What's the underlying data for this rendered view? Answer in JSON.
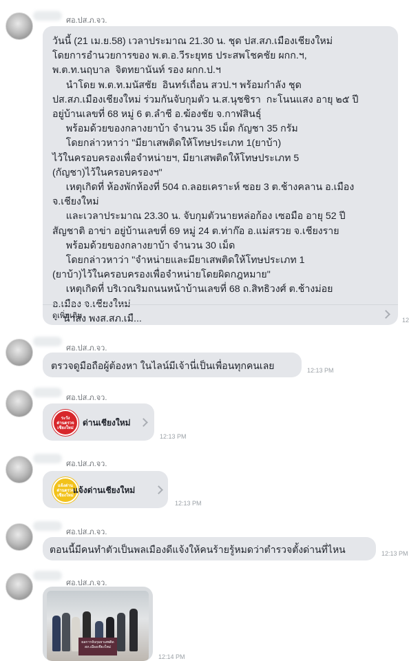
{
  "messages": [
    {
      "sender": "ศอ.ปส.ภ.จว.",
      "type": "text",
      "lines": [
        "วันนี้ (21 เม.ย.58) เวลาประมาณ 21.30 น. ชุด ปส.สภ.เมืองเชียงใหม่",
        "โดยการอำนวยการของ พ.ต.อ.วีระยุทธ ประสพโชคชัย ผกก.ฯ,",
        "พ.ต.ท.นฤบาล  จิตทยานันท์ รอง ผกก.ป.ฯ",
        "     นำโดย พ.ต.ท.มนัสชัย  อินทร์เถื่อน สวป.ฯ พร้อมกำลัง ชุด",
        "ปส.สภ.เมืองเชียงใหม่ ร่วมกันจับกุมตัว น.ส.นุชชิรา  กะโนนแสง อายุ ๒๕ ปี",
        "อยู่บ้านเลขที่ 68 หมู่ 6 ต.ลำชี อ.ฆ้องชัย จ.กาฬสินธุ์",
        "     พร้อมด้วยของกลางยาบ้า จำนวน 35 เม็ด กัญชา 35 กรัม",
        "     โดยกล่าวหาว่า \"มียาเสพติดให้โทษประเภท 1(ยาบ้า)",
        "ไว้ในครอบครองเพื่อจำหน่ายฯ, มียาเสพติดให้โทษประเภท 5",
        "(กัญชา)ไว้ในครอบครองฯ\"",
        "     เหตุเกิดที่ ห้องพักห้องที่ 504 ถ.ลอยเคราะห์ ซอย 3 ต.ช้างคลาน อ.เมือง",
        "จ.เชียงใหม่",
        "     และเวลาประมาณ 23.30 น. จับกุมตัวนายหล่อก้อง เซอมือ อายุ 52 ปี",
        "สัญชาติ อาข่า อยู่บ้านเลขที่ 69 หมู่ 24 ต.ท่าก๊อ อ.แม่สรวย จ.เชียงราย",
        "     พร้อมด้วยของกลางยาบ้า จำนวน 30 เม็ด",
        "     โดยกล่าวหาว่า \"จำหน่ายและมียาเสพติดให้โทษประเภท 1",
        "(ยาบ้า)ไว้ในครอบครองเพื่อจำหน่ายโดยผิดกฎหมาย\"",
        "     เหตุเกิดที่ บริเวณริมถนนหน้าบ้านเลขที่ 68 ถ.สิทธิวงศ์ ต.ช้างม่อย",
        "อ.เมือง จ.เชียงใหม่",
        "    นำส่ง พงส.สภ.เมื..."
      ],
      "see_more": "ดูเพิ่มเติม",
      "time": "12:"
    },
    {
      "sender": "ศอ.ปส.ภ.จว.",
      "type": "text",
      "text": "ตรวจดูมือถือผู้ต้องหา ในไลน์มีเจ้านี่เป็นเพื่อนทุกคนเลย",
      "time": "12:13 PM"
    },
    {
      "sender": "ศอ.ปส.ภ.จว.",
      "type": "link",
      "label": "ด่านเชียงใหม่",
      "logo_text": [
        "ระวัง",
        "ด่านตรวจ",
        "เชียงใหม่"
      ],
      "logo_color": "#d7262b",
      "time": "12:13 PM"
    },
    {
      "sender": "ศอ.ปส.ภ.จว.",
      "type": "link",
      "label": "แจ้งด่านเชียงใหม่",
      "logo_text": [
        "แจ้งด่าน",
        "ด่านตรวจ",
        "เชียงใหม่"
      ],
      "logo_color": "#f2c21b",
      "time": "12:13 PM"
    },
    {
      "sender": "ศอ.ปส.ภ.จว.",
      "type": "text",
      "text": "ตอนนี้มีคนทำตัวเป็นพลเมืองดีแจ้งให้คนร้ายรู้หมดว่าตำรวจตั้งด่านที่ไหน",
      "time": "12:13 PM"
    },
    {
      "sender": "ศอ.ปส.ภ.จว.",
      "type": "photo",
      "sign_text": [
        "ผลการจับกุมยาเสพติด",
        "สภ.เมืองเชียงใหม่"
      ],
      "time": "12:14 PM"
    }
  ]
}
